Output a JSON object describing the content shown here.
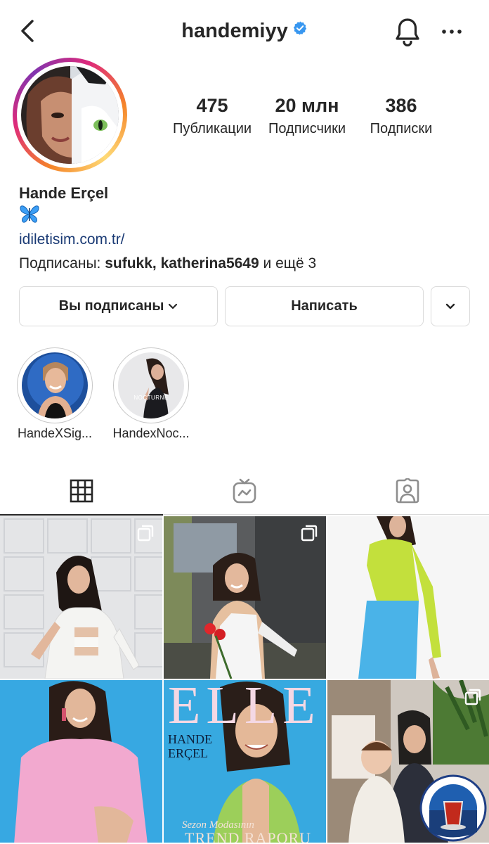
{
  "header": {
    "username": "handemiyy",
    "verified": true,
    "icons": {
      "back": "chevron-left-icon",
      "bell": "bell-icon",
      "more": "more-horizontal-icon"
    }
  },
  "profile": {
    "stats": [
      {
        "value": "475",
        "label": "Публикации"
      },
      {
        "value": "20 млн",
        "label": "Подписчики"
      },
      {
        "value": "386",
        "label": "Подписки"
      }
    ],
    "name": "Hande Erçel",
    "emoji": "🦋",
    "link": "idiletisim.com.tr/",
    "followed_by": {
      "prefix": "Подписаны: ",
      "users": "sufukk, katherina5649",
      "suffix": " и ещё 3"
    }
  },
  "actions": {
    "following_label": "Вы подписаны",
    "message_label": "Написать"
  },
  "highlights": [
    {
      "label": "HandeXSig..."
    },
    {
      "label": "HandexNoc...",
      "overlay_text": "NOCTURNE"
    }
  ],
  "tabs": [
    {
      "icon": "grid-icon",
      "active": true
    },
    {
      "icon": "igtv-icon",
      "active": false
    },
    {
      "icon": "tagged-icon",
      "active": false
    }
  ],
  "posts": [
    {
      "multi": true
    },
    {
      "multi": true
    },
    {
      "multi": false
    },
    {
      "multi": false
    },
    {
      "multi": false,
      "cover": {
        "brand": "ELLE",
        "headline": "HANDE ERÇEL",
        "footer": "TREND RAPORU",
        "footer_pre": "Sezon Modasının"
      }
    },
    {
      "multi": true
    }
  ],
  "colors": {
    "link": "#1b3b75",
    "verified": "#3897f0",
    "text": "#262626",
    "border": "#dbdbdb"
  }
}
